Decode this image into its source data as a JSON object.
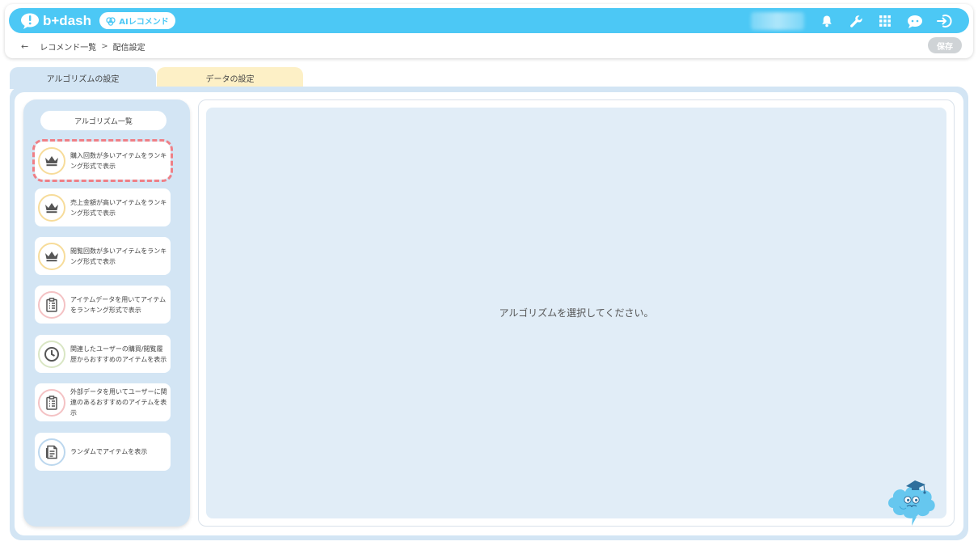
{
  "header": {
    "logo_text": "b+dash",
    "ai_badge": "AIレコメンド",
    "icons": [
      "bell-icon",
      "wrench-icon",
      "grid-icon",
      "chat-icon",
      "logout-icon"
    ]
  },
  "breadcrumb": {
    "back": "←",
    "items": [
      "レコメンド一覧",
      "配信設定"
    ],
    "separator": ">"
  },
  "toolbar": {
    "save_label": "保存"
  },
  "tabs": [
    {
      "label": "アルゴリズムの設定",
      "active": true
    },
    {
      "label": "データの設定",
      "active": false
    }
  ],
  "sidebar": {
    "title": "アルゴリズム一覧",
    "items": [
      {
        "label": "購入回数が多いアイテムをランキング形式で表示",
        "icon": "crown-icon",
        "color": "#f7dc9a",
        "selected": true
      },
      {
        "label": "売上金額が高いアイテムをランキング形式で表示",
        "icon": "crown-icon",
        "color": "#f7dc9a",
        "selected": false
      },
      {
        "label": "閲覧回数が多いアイテムをランキング形式で表示",
        "icon": "crown-icon",
        "color": "#f7dc9a",
        "selected": false
      },
      {
        "label": "アイテムデータを用いてアイテムをランキング形式で表示",
        "icon": "clipboard-icon",
        "color": "#f4c2c4",
        "selected": false
      },
      {
        "label": "関連したユーザーの購買/閲覧履歴からおすすめのアイテムを表示",
        "icon": "clock-icon",
        "color": "#d9e6c4",
        "selected": false
      },
      {
        "label": "外部データを用いてユーザーに関連のあるおすすめのアイテムを表示",
        "icon": "clipboard-icon",
        "color": "#f4c2c4",
        "selected": false
      },
      {
        "label": "ランダムでアイテムを表示",
        "icon": "document-icon",
        "color": "#bcd7ee",
        "selected": false
      }
    ]
  },
  "main": {
    "placeholder": "アルゴリズムを選択してください。"
  },
  "colors": {
    "brand": "#4cc8f5",
    "panel": "#d3e5f4",
    "content": "#e1edf7",
    "selected_outline": "#ef7f86",
    "save_disabled": "#cfd3d6"
  }
}
